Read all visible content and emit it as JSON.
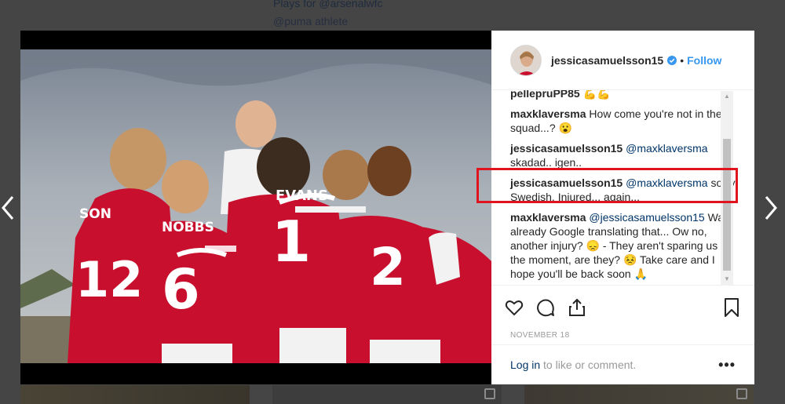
{
  "background": {
    "bio_line_1": "Plays for @arsenalwfc",
    "bio_line_2": "@puma athlete"
  },
  "post": {
    "username": "jessicasamuelsson15",
    "separator": "•",
    "follow_label": "Follow",
    "date": "NOVEMBER 18",
    "image_alt": "Arsenal women's team huddle",
    "jersey_names": [
      "EVANS",
      "NOBBS",
      "SON"
    ],
    "jersey_numbers": [
      "1",
      "6",
      "12",
      "2"
    ]
  },
  "comments": [
    {
      "user": "pellepruPP85",
      "mention": "",
      "text": "💪💪"
    },
    {
      "user": "maxklaversma",
      "mention": "",
      "text": "How come you're not in the squad...? 😮"
    },
    {
      "user": "jessicasamuelsson15",
      "mention": "@maxklaversma",
      "text": "skadad.. igen.."
    },
    {
      "user": "jessicasamuelsson15",
      "mention": "@maxklaversma",
      "text": "sorry Swedish. Injured... again..."
    },
    {
      "user": "maxklaversma",
      "mention": "@jessicasamuelsson15",
      "text": "Was already Google translating that... Ow no, another injury? 😞 - They aren't sparing us at the moment, are they? 😣 Take care and I hope you'll be back soon 🙏"
    }
  ],
  "actions": {
    "like": "heart-icon",
    "comment": "comment-icon",
    "share": "share-icon",
    "save": "bookmark-icon"
  },
  "login": {
    "link": "Log in",
    "rest": " to like or comment.",
    "more": "•••"
  },
  "colors": {
    "accent": "#3897f0",
    "highlight": "#e0141e",
    "overlay": "#454545"
  }
}
